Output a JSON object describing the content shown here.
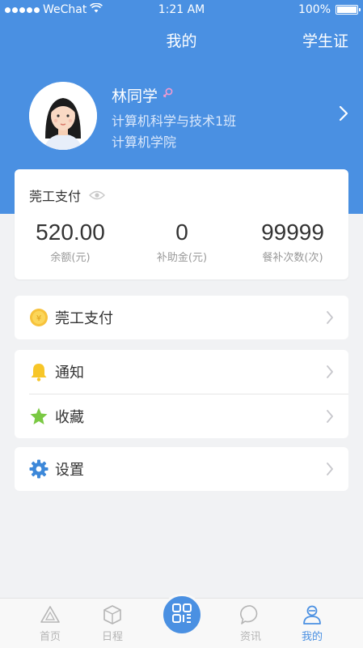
{
  "status_bar": {
    "carrier": "WeChat",
    "time": "1:21 AM",
    "battery": "100%"
  },
  "nav": {
    "title": "我的",
    "action_label": "学生证"
  },
  "profile": {
    "name": "林同学",
    "major": "计算机科学与技术1班",
    "college": "计算机学院"
  },
  "balance_card": {
    "title": "莞工支付",
    "stats": [
      {
        "value": "520.00",
        "label": "余额(元)"
      },
      {
        "value": "0",
        "label": "补助金(元)"
      },
      {
        "value": "99999",
        "label": "餐补次数(次)"
      }
    ]
  },
  "menu": {
    "pay": "莞工支付",
    "notify": "通知",
    "favorite": "收藏",
    "settings": "设置"
  },
  "tabbar": {
    "home": "首页",
    "schedule": "日程",
    "news": "资讯",
    "mine": "我的"
  },
  "colors": {
    "brand": "#4a90e2",
    "background": "#f1f2f4",
    "tab_inactive": "#b5b5b5"
  },
  "icons": {
    "pay": "coin-icon",
    "notify": "bell-icon",
    "favorite": "star-icon",
    "settings": "gear-icon",
    "scan": "qr-code-icon"
  }
}
